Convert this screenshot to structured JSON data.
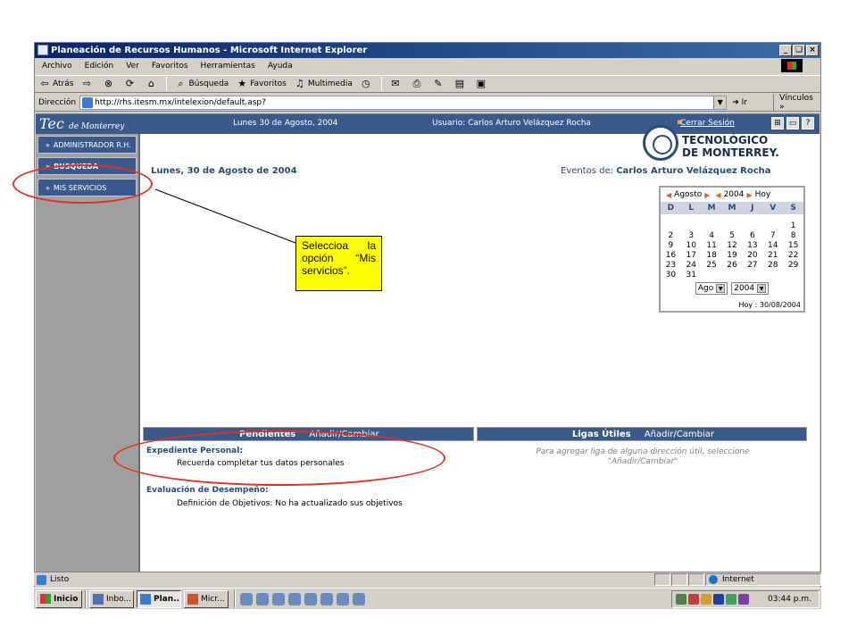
{
  "window": {
    "title": "Planeación de Recursos Humanos - Microsoft Internet Explorer",
    "controls": [
      "_",
      "❑",
      "×"
    ]
  },
  "menu": [
    "Archivo",
    "Edición",
    "Ver",
    "Favoritos",
    "Herramientas",
    "Ayuda"
  ],
  "toolbar": {
    "back": "Atrás",
    "search": "Búsqueda",
    "favorites": "Favoritos",
    "multimedia": "Multimedia"
  },
  "address": {
    "label": "Dirección",
    "url": "http://rhs.itesm.mx/intelexion/default.asp?",
    "go": "Ir",
    "links": "Vínculos"
  },
  "app": {
    "logo_main": "Tec",
    "logo_sub": "de Monterrey",
    "date": "Lunes 30 de Agosto, 2004",
    "user": "Usuario: Carlos Arturo Velázquez Rocha",
    "logout": "Cerrar Sesión",
    "brand_line1": "TECNOLÓGICO",
    "brand_line2": "DE MONTERREY."
  },
  "nav": [
    "ADMINISTRADOR R.H.",
    "BUSQUEDA",
    "MIS SERVICIOS"
  ],
  "main": {
    "title": "Lunes, 30 de Agosto de 2004",
    "events_label": "Eventos de:",
    "events_user": "Carlos Arturo Velázquez Rocha"
  },
  "calendar": {
    "month": "Agosto",
    "year": "2004",
    "today_link": "Hoy",
    "days": [
      "D",
      "L",
      "M",
      "M",
      "J",
      "V",
      "S"
    ],
    "dates": [
      "1",
      "2",
      "3",
      "4",
      "5",
      "6",
      "7",
      "8",
      "9",
      "10",
      "11",
      "12",
      "13",
      "14",
      "15",
      "16",
      "17",
      "18",
      "19",
      "20",
      "21",
      "22",
      "23",
      "24",
      "25",
      "26",
      "27",
      "28",
      "29",
      "30",
      "31"
    ],
    "month_select": "Ago",
    "year_select": "2004",
    "today_text": "Hoy : 30/08/2004"
  },
  "pendientes": {
    "title": "Pendientes",
    "action": "Añadir/Cambiar",
    "section1": "Expediente Personal:",
    "item1": "Recuerda completar tus datos personales",
    "section2": "Evaluación de Desempeño:",
    "item2": "Definición de Objetivos: No ha actualizado sus objetivos"
  },
  "ligas": {
    "title": "Ligas Útiles",
    "action": "Añadir/Cambiar",
    "hint": "Para agregar liga de alguna dirección útil, seleccione \"Añadir/Cambiar\""
  },
  "callout": {
    "text": "Seleccioa la opción “Mis servicios”."
  },
  "status": {
    "text": "Listo",
    "zone": "Internet"
  },
  "taskbar": {
    "start": "Inicio",
    "tasks": [
      "Inbo...",
      "Plan...",
      "Micr..."
    ],
    "clock": "03:44 p.m."
  },
  "colors": {
    "header_blue": "#3a5a8c",
    "annotation_red": "#e03020",
    "callout_yellow": "#ffff00"
  }
}
